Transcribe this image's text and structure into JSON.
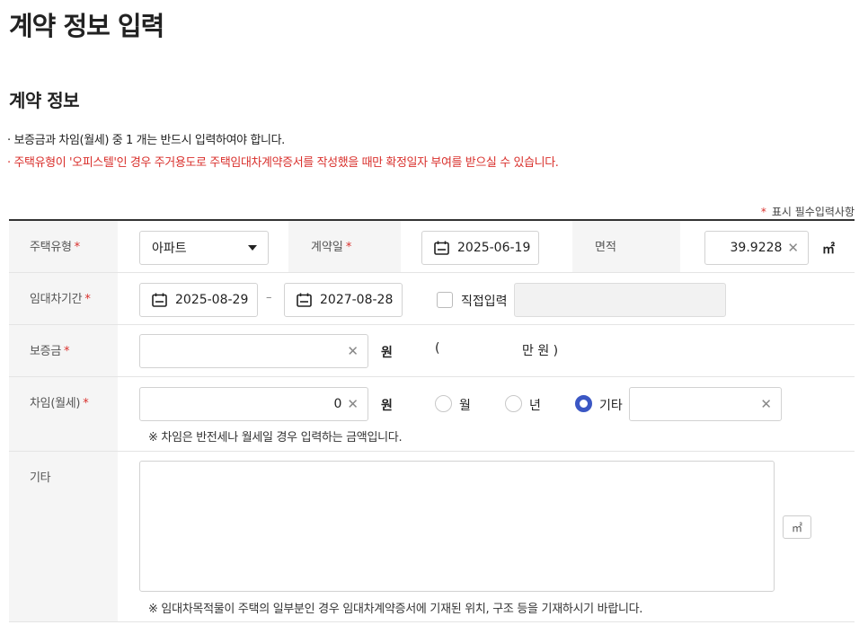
{
  "page": {
    "title": "계약 정보 입력"
  },
  "section": {
    "title": "계약 정보",
    "notices": [
      "· 보증금과 차임(월세) 중 1 개는 반드시 입력하여야 합니다.",
      "· 주택유형이 '오피스텔'인 경우 주거용도로 주택임대차계약증서를 작성했을 때만 확정일자 부여를 받으실 수 있습니다."
    ],
    "required_legend": {
      "star": "*",
      "text": "표시 필수입력사항"
    }
  },
  "form": {
    "required_mark": "*",
    "housing_type": {
      "label": "주택유형",
      "value": "아파트"
    },
    "contract_date": {
      "label": "계약일",
      "value": "2025-06-19"
    },
    "area": {
      "label": "면적",
      "value": "39.9228",
      "clear": "✕",
      "unit": "㎡"
    },
    "lease_period": {
      "label": "임대차기간",
      "start": "2025-08-29",
      "separator": "–",
      "end": "2027-08-28",
      "direct_input_label": "직접입력",
      "direct_input_checked": false,
      "direct_input_value": ""
    },
    "deposit": {
      "label": "보증금",
      "value": "",
      "clear": "✕",
      "unit": "원",
      "korean_open": "(",
      "korean_text": "만 원 )"
    },
    "rent": {
      "label": "차임(월세)",
      "value": "0",
      "clear": "✕",
      "unit": "원",
      "period_options": [
        "월",
        "년",
        "기타"
      ],
      "selected_period": "기타",
      "other_value": "",
      "other_clear": "✕",
      "hint": "※ 차임은 반전세나 월세일 경우 입력하는 금액입니다."
    },
    "other": {
      "label": "기타",
      "value": "",
      "unit_button": "㎡",
      "hint": "※ 임대차목적물이 주택의 일부분인 경우 임대차계약증서에 기재된 위치, 구조 등을 기재하시기 바랍니다."
    }
  }
}
